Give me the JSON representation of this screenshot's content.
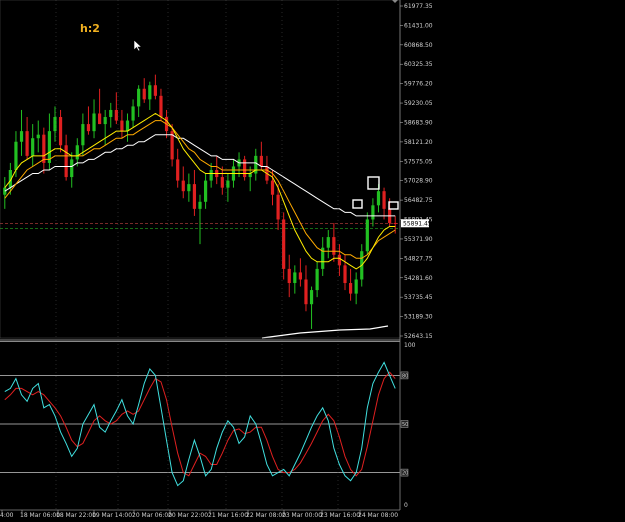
{
  "timeframe_label": "h:2",
  "colors": {
    "background": "#000000",
    "bull_candle": "#22c022",
    "bear_candle": "#e02020",
    "ma_fast": "#ffee00",
    "ma_mid": "#ffaa00",
    "ma_slow": "#ffffff",
    "price_line": "#c04040",
    "grid": "#505050",
    "stoch_main": "#40e0e0",
    "stoch_signal": "#e02020",
    "level_line": "#c8c8c8"
  },
  "price_axis": {
    "ticks": [
      "61977.35",
      "61431.00",
      "60868.50",
      "60325.35",
      "59776.20",
      "59230.05",
      "58683.90",
      "58121.20",
      "57575.05",
      "57028.90",
      "56482.75",
      "55891.45",
      "55371.90",
      "54827.75",
      "54281.60",
      "53735.45",
      "53189.30",
      "52643.15"
    ],
    "current_price": "55891.45"
  },
  "time_axis": {
    "ticks": [
      "4:00",
      "18 Mar 06:00",
      "18 Mar 22:00",
      "19 Mar 14:00",
      "20 Mar 06:00",
      "20 Mar 22:00",
      "21 Mar 16:00",
      "22 Mar 08:00",
      "23 Mar 00:00",
      "23 Mar 16:00",
      "24 Mar 08:00"
    ]
  },
  "oscillator": {
    "max": "100",
    "levels": [
      "80",
      "50",
      "20"
    ],
    "min": "0"
  },
  "icons": [
    "mouse-cursor-icon",
    "scroll-marker-icon"
  ],
  "chart_data": {
    "type": "candlestick",
    "title": "",
    "ylim": [
      52643.15,
      62100
    ],
    "candles": [
      {
        "o": 56700,
        "h": 57200,
        "l": 56300,
        "c": 56900
      },
      {
        "o": 56900,
        "h": 57600,
        "l": 56700,
        "c": 57400
      },
      {
        "o": 57400,
        "h": 58500,
        "l": 57200,
        "c": 58200
      },
      {
        "o": 58200,
        "h": 59100,
        "l": 57800,
        "c": 58500
      },
      {
        "o": 58500,
        "h": 58900,
        "l": 57700,
        "c": 57800
      },
      {
        "o": 57800,
        "h": 58700,
        "l": 57500,
        "c": 58300
      },
      {
        "o": 58300,
        "h": 58800,
        "l": 57900,
        "c": 58400
      },
      {
        "o": 58400,
        "h": 58600,
        "l": 57300,
        "c": 57600
      },
      {
        "o": 57600,
        "h": 59000,
        "l": 57400,
        "c": 58500
      },
      {
        "o": 58500,
        "h": 59200,
        "l": 58200,
        "c": 58900
      },
      {
        "o": 58900,
        "h": 59100,
        "l": 57900,
        "c": 58100
      },
      {
        "o": 58100,
        "h": 58400,
        "l": 57100,
        "c": 57200
      },
      {
        "o": 57200,
        "h": 57900,
        "l": 56900,
        "c": 57700
      },
      {
        "o": 57700,
        "h": 58300,
        "l": 57500,
        "c": 58100
      },
      {
        "o": 58100,
        "h": 59000,
        "l": 57800,
        "c": 58700
      },
      {
        "o": 58700,
        "h": 59200,
        "l": 58400,
        "c": 58500
      },
      {
        "o": 58500,
        "h": 59400,
        "l": 58300,
        "c": 59000
      },
      {
        "o": 59000,
        "h": 59700,
        "l": 58700,
        "c": 58700
      },
      {
        "o": 58700,
        "h": 59100,
        "l": 58100,
        "c": 58900
      },
      {
        "o": 58900,
        "h": 59300,
        "l": 58600,
        "c": 59100
      },
      {
        "o": 59100,
        "h": 59600,
        "l": 58700,
        "c": 58800
      },
      {
        "o": 58800,
        "h": 59100,
        "l": 58300,
        "c": 58500
      },
      {
        "o": 58500,
        "h": 59000,
        "l": 58200,
        "c": 58800
      },
      {
        "o": 58800,
        "h": 59400,
        "l": 58600,
        "c": 59200
      },
      {
        "o": 59200,
        "h": 59800,
        "l": 58900,
        "c": 59700
      },
      {
        "o": 59700,
        "h": 60000,
        "l": 59300,
        "c": 59400
      },
      {
        "o": 59400,
        "h": 59900,
        "l": 59100,
        "c": 59800
      },
      {
        "o": 59800,
        "h": 60100,
        "l": 59400,
        "c": 59500
      },
      {
        "o": 59500,
        "h": 59700,
        "l": 58800,
        "c": 58900
      },
      {
        "o": 58900,
        "h": 59100,
        "l": 58300,
        "c": 58500
      },
      {
        "o": 58500,
        "h": 58700,
        "l": 57500,
        "c": 57700
      },
      {
        "o": 57700,
        "h": 58000,
        "l": 56900,
        "c": 57100
      },
      {
        "o": 57100,
        "h": 57500,
        "l": 56600,
        "c": 56800
      },
      {
        "o": 56800,
        "h": 57300,
        "l": 56500,
        "c": 57000
      },
      {
        "o": 57000,
        "h": 57400,
        "l": 56100,
        "c": 56300
      },
      {
        "o": 56300,
        "h": 56700,
        "l": 55300,
        "c": 56500
      },
      {
        "o": 56500,
        "h": 57300,
        "l": 56300,
        "c": 57100
      },
      {
        "o": 57100,
        "h": 57600,
        "l": 56900,
        "c": 57400
      },
      {
        "o": 57400,
        "h": 57800,
        "l": 57000,
        "c": 57200
      },
      {
        "o": 57200,
        "h": 57500,
        "l": 56700,
        "c": 56900
      },
      {
        "o": 56900,
        "h": 57300,
        "l": 56500,
        "c": 57100
      },
      {
        "o": 57100,
        "h": 57700,
        "l": 56900,
        "c": 57500
      },
      {
        "o": 57500,
        "h": 57900,
        "l": 57200,
        "c": 57700
      },
      {
        "o": 57700,
        "h": 57800,
        "l": 57100,
        "c": 57200
      },
      {
        "o": 57200,
        "h": 57500,
        "l": 56800,
        "c": 57300
      },
      {
        "o": 57300,
        "h": 58000,
        "l": 57100,
        "c": 57800
      },
      {
        "o": 57800,
        "h": 58200,
        "l": 57400,
        "c": 57500
      },
      {
        "o": 57500,
        "h": 57800,
        "l": 57000,
        "c": 57100
      },
      {
        "o": 57100,
        "h": 57400,
        "l": 56400,
        "c": 56700
      },
      {
        "o": 56700,
        "h": 57000,
        "l": 55700,
        "c": 56000
      },
      {
        "o": 56000,
        "h": 56200,
        "l": 54300,
        "c": 54600
      },
      {
        "o": 54600,
        "h": 55000,
        "l": 53800,
        "c": 54200
      },
      {
        "o": 54200,
        "h": 54700,
        "l": 53900,
        "c": 54500
      },
      {
        "o": 54500,
        "h": 54900,
        "l": 54100,
        "c": 54300
      },
      {
        "o": 54300,
        "h": 54700,
        "l": 53400,
        "c": 53600
      },
      {
        "o": 53600,
        "h": 54100,
        "l": 52900,
        "c": 54000
      },
      {
        "o": 54000,
        "h": 54800,
        "l": 53800,
        "c": 54600
      },
      {
        "o": 54600,
        "h": 55500,
        "l": 54400,
        "c": 55200
      },
      {
        "o": 55200,
        "h": 55700,
        "l": 54900,
        "c": 55500
      },
      {
        "o": 55500,
        "h": 55900,
        "l": 54800,
        "c": 55000
      },
      {
        "o": 55000,
        "h": 55300,
        "l": 54400,
        "c": 54700
      },
      {
        "o": 54700,
        "h": 55000,
        "l": 54000,
        "c": 54200
      },
      {
        "o": 54200,
        "h": 54600,
        "l": 53700,
        "c": 53900
      },
      {
        "o": 53900,
        "h": 54500,
        "l": 53600,
        "c": 54300
      },
      {
        "o": 54300,
        "h": 55300,
        "l": 54100,
        "c": 55100
      },
      {
        "o": 55100,
        "h": 56200,
        "l": 55000,
        "c": 56000
      },
      {
        "o": 56000,
        "h": 56600,
        "l": 55800,
        "c": 56400
      },
      {
        "o": 56400,
        "h": 57000,
        "l": 56200,
        "c": 56800
      },
      {
        "o": 56800,
        "h": 56900,
        "l": 56000,
        "c": 56300
      },
      {
        "o": 56300,
        "h": 56600,
        "l": 55800,
        "c": 55900
      },
      {
        "o": 55900,
        "h": 56100,
        "l": 55600,
        "c": 55891
      }
    ],
    "ma_fast": [
      56900,
      57100,
      57400,
      57600,
      57700,
      57800,
      57800,
      57800,
      57900,
      58000,
      58000,
      57900,
      57800,
      57800,
      57900,
      58000,
      58100,
      58200,
      58300,
      58400,
      58500,
      58500,
      58500,
      58600,
      58700,
      58800,
      58900,
      59000,
      58900,
      58800,
      58600,
      58300,
      58000,
      57800,
      57600,
      57400,
      57300,
      57300,
      57300,
      57300,
      57300,
      57300,
      57300,
      57300,
      57300,
      57400,
      57400,
      57300,
      57200,
      56900,
      56500,
      56100,
      55700,
      55400,
      55100,
      54900,
      54800,
      54800,
      54800,
      54900,
      54900,
      54800,
      54700,
      54600,
      54700,
      54900,
      55200,
      55500,
      55700,
      55800,
      55800
    ],
    "ma_mid": [
      56600,
      56800,
      57000,
      57200,
      57400,
      57500,
      57600,
      57700,
      57700,
      57800,
      57800,
      57800,
      57800,
      57800,
      57800,
      57900,
      58000,
      58000,
      58100,
      58200,
      58300,
      58300,
      58400,
      58400,
      58500,
      58600,
      58700,
      58800,
      58800,
      58700,
      58600,
      58400,
      58200,
      58000,
      57900,
      57700,
      57600,
      57500,
      57500,
      57400,
      57400,
      57400,
      57400,
      57400,
      57400,
      57400,
      57400,
      57400,
      57300,
      57100,
      56800,
      56500,
      56200,
      55900,
      55600,
      55400,
      55200,
      55100,
      55100,
      55100,
      55100,
      55000,
      55000,
      54900,
      54900,
      55000,
      55200,
      55400,
      55500,
      55600,
      55700
    ],
    "ma_slow": [
      56800,
      56900,
      57000,
      57100,
      57200,
      57300,
      57300,
      57400,
      57400,
      57500,
      57500,
      57500,
      57500,
      57600,
      57600,
      57700,
      57700,
      57800,
      57900,
      57900,
      58000,
      58000,
      58100,
      58100,
      58200,
      58200,
      58300,
      58400,
      58400,
      58400,
      58400,
      58300,
      58300,
      58200,
      58100,
      58000,
      57900,
      57800,
      57800,
      57700,
      57700,
      57700,
      57600,
      57600,
      57600,
      57600,
      57500,
      57500,
      57400,
      57300,
      57200,
      57100,
      57000,
      56900,
      56800,
      56700,
      56600,
      56500,
      56400,
      56300,
      56300,
      56200,
      56200,
      56100,
      56100,
      56100,
      56100,
      56100,
      56100,
      56100,
      56100
    ],
    "stoch_main": [
      70,
      72,
      78,
      68,
      64,
      72,
      75,
      60,
      62,
      55,
      45,
      38,
      30,
      35,
      50,
      56,
      62,
      48,
      45,
      52,
      58,
      65,
      55,
      50,
      62,
      75,
      84,
      80,
      60,
      40,
      20,
      12,
      15,
      28,
      40,
      30,
      18,
      22,
      35,
      45,
      52,
      48,
      38,
      42,
      55,
      50,
      38,
      25,
      18,
      20,
      22,
      18,
      25,
      32,
      40,
      48,
      55,
      60,
      52,
      35,
      25,
      18,
      15,
      20,
      35,
      60,
      75,
      82,
      88,
      80,
      72
    ],
    "stoch_signal": [
      65,
      68,
      72,
      72,
      70,
      68,
      70,
      68,
      64,
      60,
      55,
      48,
      40,
      36,
      38,
      45,
      52,
      55,
      52,
      50,
      52,
      56,
      58,
      56,
      58,
      65,
      72,
      78,
      76,
      65,
      48,
      32,
      20,
      18,
      25,
      32,
      30,
      25,
      25,
      32,
      40,
      46,
      47,
      44,
      45,
      48,
      48,
      40,
      30,
      22,
      20,
      20,
      22,
      26,
      32,
      38,
      45,
      52,
      56,
      52,
      42,
      30,
      22,
      18,
      22,
      36,
      52,
      68,
      78,
      82,
      78
    ],
    "x_ticks": [
      "4:00",
      "18 Mar 06:00",
      "18 Mar 22:00",
      "19 Mar 14:00",
      "20 Mar 06:00",
      "20 Mar 22:00",
      "21 Mar 16:00",
      "22 Mar 08:00",
      "23 Mar 00:00",
      "23 Mar 16:00",
      "24 Mar 08:00"
    ],
    "oscillator_levels": [
      80,
      50,
      20
    ],
    "grid": false
  }
}
